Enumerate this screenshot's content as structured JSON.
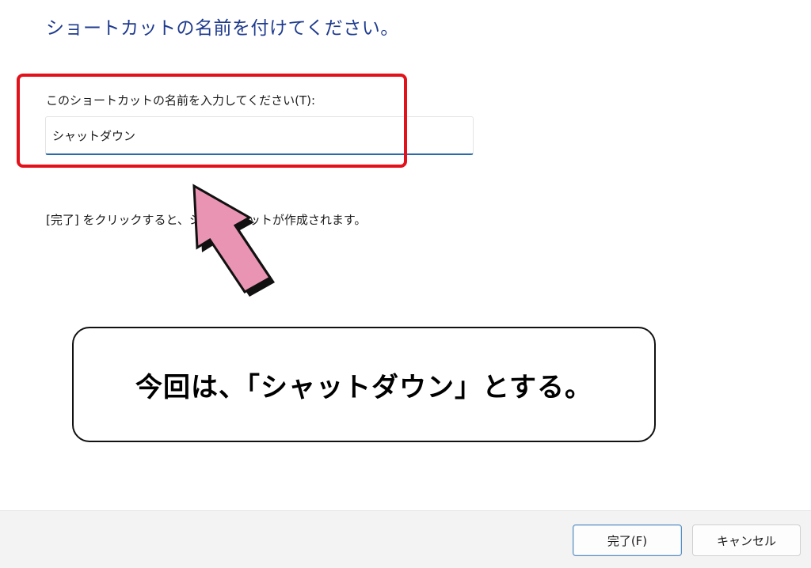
{
  "page": {
    "title": "ショートカットの名前を付けてください。"
  },
  "form": {
    "name_label": "このショートカットの名前を入力してください(T):",
    "name_value": "シャットダウン",
    "finish_note": "[完了] をクリックすると、ショートカットが作成されます。"
  },
  "annotation": {
    "callout_text": "今回は、「シャットダウン」とする。",
    "highlight_color": "#e2111a",
    "arrow_color": "#ea94b4",
    "arrow_icon": "up-left-arrow-icon"
  },
  "footer": {
    "finish_label": "完了(F)",
    "cancel_label": "キャンセル"
  }
}
